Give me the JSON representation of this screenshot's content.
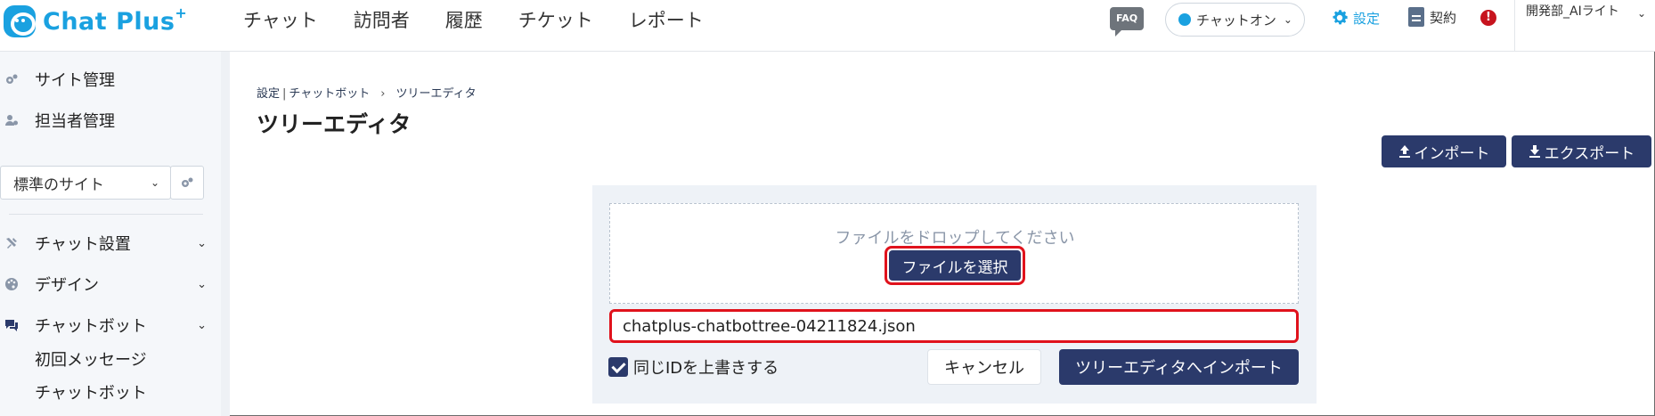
{
  "header": {
    "logo_text": "Chat Plus",
    "logo_sup": "+",
    "nav": [
      "チャット",
      "訪問者",
      "履歴",
      "チケット",
      "レポート"
    ],
    "faq_label": "FAQ",
    "chat_status": "チャットオン",
    "settings_label": "設定",
    "contract_label": "契約",
    "alert_symbol": "!",
    "user_name": "開発部_AIライト"
  },
  "sidebar": {
    "top_items": [
      "サイト管理",
      "担当者管理"
    ],
    "site_select": "標準のサイト",
    "menu_items": [
      "チャット設置",
      "デザイン",
      "チャットボット"
    ],
    "sub_items": [
      "初回メッセージ",
      "チャットボット"
    ]
  },
  "main": {
    "breadcrumb": [
      "設定",
      "チャットボット",
      "ツリーエディタ"
    ],
    "breadcrumb_separators": [
      "|",
      "›"
    ],
    "title": "ツリーエディタ",
    "import_label": "インポート",
    "export_label": "エクスポート",
    "drop_text": "ファイルをドロップしてください",
    "select_file_label": "ファイルを選択",
    "file_name": "chatplus-chatbottree-04211824.json",
    "overwrite_label": "同じIDを上書きする",
    "overwrite_checked": true,
    "cancel_label": "キャンセル",
    "import_to_tree_label": "ツリーエディタへインポート"
  },
  "colors": {
    "brand": "#1aa1e0",
    "navy": "#2b3a6b",
    "highlight": "#e0121c",
    "alert": "#c7141e"
  }
}
